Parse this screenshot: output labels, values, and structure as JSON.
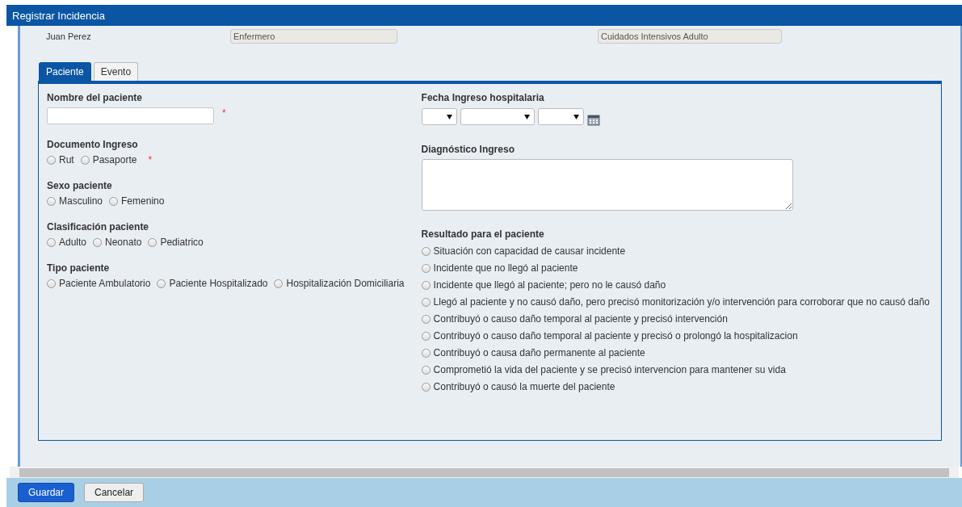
{
  "window": {
    "title": "Registrar Incidencia"
  },
  "header": {
    "user": "Juan Perez",
    "role": "Enfermero",
    "unit": "Cuidados Intensivos Adulto"
  },
  "tabs": [
    {
      "label": "Paciente",
      "selected": true
    },
    {
      "label": "Evento",
      "selected": false
    }
  ],
  "left_fields": [
    {
      "kind": "text",
      "label": "Nombre del paciente",
      "required": true
    },
    {
      "kind": "radio",
      "label": "Documento Ingreso",
      "required": true,
      "options": [
        {
          "label": "Rut",
          "selected": false
        },
        {
          "label": "Pasaporte",
          "selected": false
        }
      ]
    },
    {
      "kind": "radio",
      "label": "Sexo paciente",
      "required": false,
      "options": [
        {
          "label": "Masculino",
          "selected": false
        },
        {
          "label": "Femenino",
          "selected": false
        }
      ]
    },
    {
      "kind": "radio",
      "label": "Clasificación paciente",
      "required": false,
      "options": [
        {
          "label": "Adulto",
          "selected": false
        },
        {
          "label": "Neonato",
          "selected": false
        },
        {
          "label": "Pediatrico",
          "selected": false
        }
      ]
    },
    {
      "kind": "radio",
      "label": "Tipo paciente",
      "required": false,
      "options": [
        {
          "label": "Paciente Ambulatorio",
          "selected": false
        },
        {
          "label": "Paciente Hospitalizado",
          "selected": false
        },
        {
          "label": "Hospitalización Domiciliaria",
          "selected": false
        }
      ]
    }
  ],
  "admission_date": {
    "label": "Fecha Ingreso hospitalaria"
  },
  "diagnosis": {
    "label": "Diagnóstico Ingreso"
  },
  "outcome": {
    "label": "Resultado para el paciente",
    "options": [
      {
        "label": "Situación con capacidad de causar incidente",
        "selected": false
      },
      {
        "label": "Incidente que no llegó al paciente",
        "selected": false
      },
      {
        "label": "Incidente que llegó al paciente; pero no le causó daño",
        "selected": false
      },
      {
        "label": "Llegó al paciente y no causó daño, pero precisó monitorización y/o intervención para corroborar que no causó daño",
        "selected": false
      },
      {
        "label": "Contribuyó o causo daño temporal al paciente y precisó intervención",
        "selected": false
      },
      {
        "label": "Contribuyó o causo daño temporal al paciente y precisó o prolongó la hospitalizacion",
        "selected": false
      },
      {
        "label": "Contribuyó o causa daño permanente al paciente",
        "selected": false
      },
      {
        "label": "Comprometió la vida del paciente y se precisó intervencion para mantener su vida",
        "selected": false
      },
      {
        "label": "Contribuyó o causó la muerte del paciente",
        "selected": false
      }
    ]
  },
  "required_mark": "*",
  "buttons": [
    {
      "label": "Guardar",
      "kind": "primary"
    },
    {
      "label": "Cancelar",
      "kind": "secondary"
    }
  ]
}
